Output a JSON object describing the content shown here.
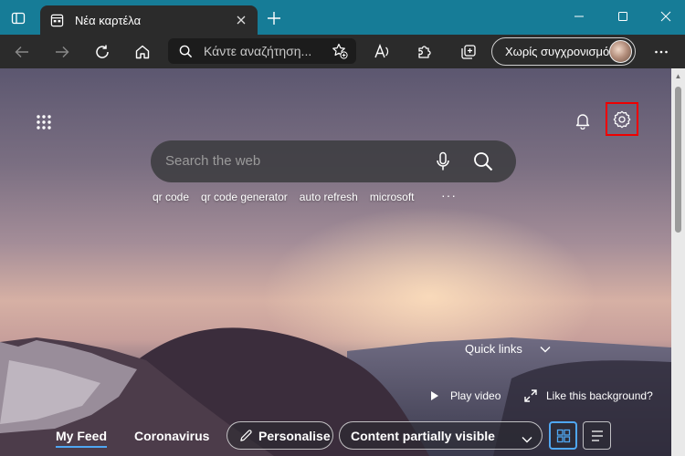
{
  "browser": {
    "tab": {
      "title": "Νέα καρτέλα"
    },
    "address_placeholder": "Κάντε αναζήτηση στο Bing ή πληκτρολογήστε μια διεύθυνση URL",
    "address_visible": "Κάντε αναζήτηση...",
    "sync_button": {
      "label": "Χωρίς συγχρονισμό"
    },
    "accent_color": "#167c97",
    "highlight_color": "#e00000"
  },
  "newtab": {
    "search": {
      "placeholder": "Search the web",
      "suggestions": [
        "qr code",
        "qr code generator",
        "auto refresh",
        "microsoft"
      ],
      "more": "···"
    },
    "quick_links_label": "Quick links",
    "play_video_label": "Play video",
    "like_background_label": "Like this background?",
    "feed": {
      "tabs": [
        "My Feed",
        "Coronavirus"
      ],
      "personalise_label": "Personalise",
      "content_visibility": "Content partially visible"
    }
  }
}
